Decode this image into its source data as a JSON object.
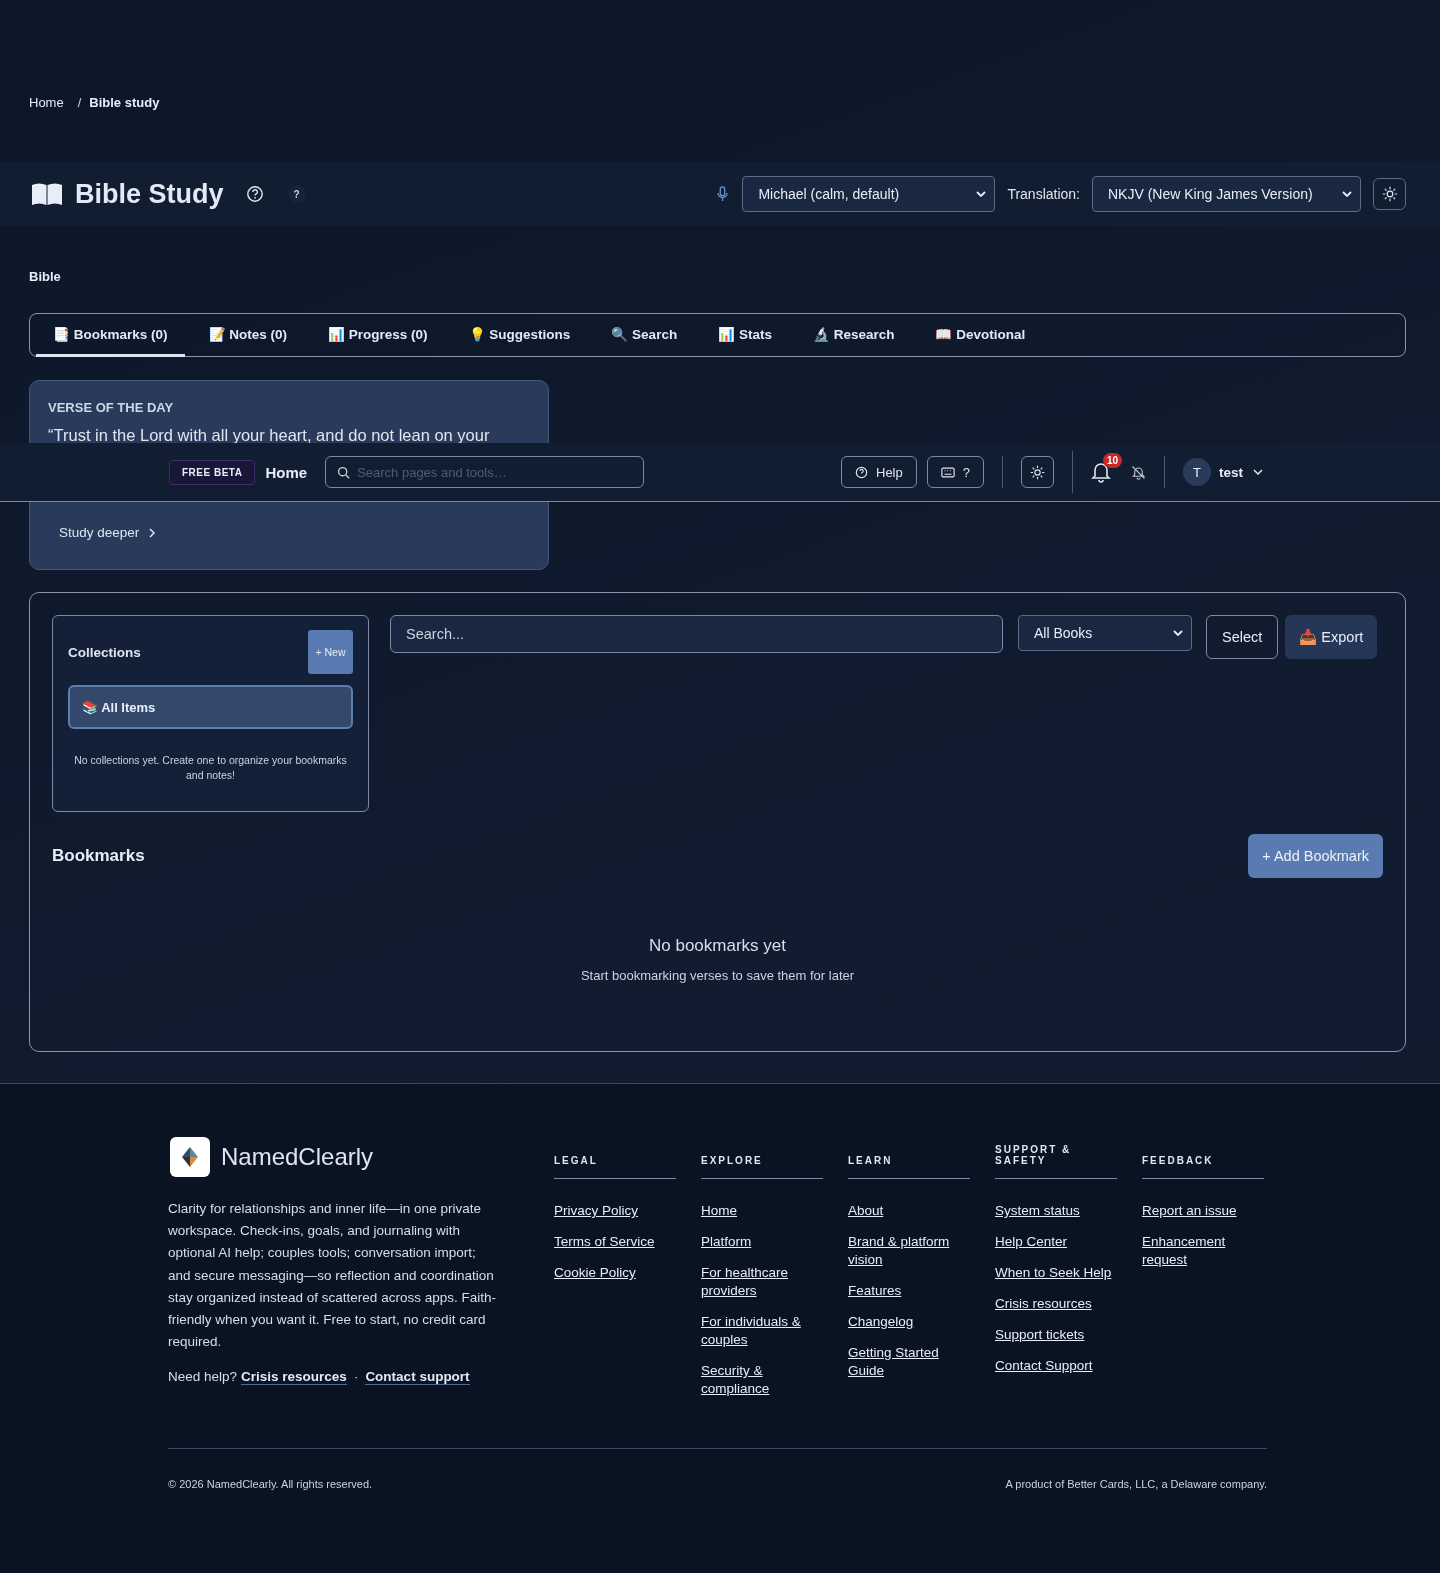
{
  "breadcrumb": [
    {
      "label": "Home",
      "current": false
    },
    {
      "label": "Bible study",
      "current": true
    }
  ],
  "breadcrumb_separator": "/",
  "header": {
    "title": "Bible Study",
    "help_badge": "?",
    "voice": "Michael (calm, default)",
    "translation_label": "Translation:",
    "translation": "NKJV (New King James Version)"
  },
  "section_label": "Bible",
  "tabs": [
    {
      "label": "📑 Bookmarks (0)",
      "selected": true
    },
    {
      "label": "📝 Notes (0)",
      "selected": false
    },
    {
      "label": "📊 Progress (0)",
      "selected": false
    },
    {
      "label": "💡 Suggestions",
      "selected": false
    },
    {
      "label": "🔍 Search",
      "selected": false
    },
    {
      "label": "📊 Stats",
      "selected": false
    },
    {
      "label": "🔬 Research",
      "selected": false
    },
    {
      "label": "📖 Devotional",
      "selected": false
    }
  ],
  "verse_card": {
    "heading": "VERSE OF THE DAY",
    "text": "“Trust in the Lord with all your heart, and do not lean on your",
    "link": "Study deeper"
  },
  "top_nav": {
    "badge": "FREE BETA",
    "home": "Home",
    "search_placeholder": "Search pages and tools…",
    "help": "Help",
    "shortcut": "?",
    "notification_count": "10",
    "user_initial": "T",
    "user_name": "test"
  },
  "collections": {
    "title": "Collections",
    "new_button": "+ New",
    "items": [
      {
        "label": "📚 All Items",
        "selected": true
      }
    ],
    "empty": "No collections yet. Create one to organize your bookmarks and notes!"
  },
  "filters": {
    "search_placeholder": "Search...",
    "book_filter": "All Books",
    "select_button": "Select",
    "export_button": "📥 Export"
  },
  "bookmarks": {
    "title": "Bookmarks",
    "add_button": "+ Add Bookmark",
    "empty_title": "No bookmarks yet",
    "empty_text": "Start bookmarking verses to save them for later"
  },
  "footer": {
    "brand": "NamedClearly",
    "description": "Clarity for relationships and inner life—in one private workspace. Check-ins, goals, and journaling with optional AI help; couples tools; conversation import; and secure messaging—so reflection and coordination stay organized instead of scattered across apps. Faith-friendly when you want it. Free to start, no credit card required.",
    "help_prefix": "Need help?",
    "help_links": [
      "Crisis resources",
      "Contact support"
    ],
    "help_separator": "·",
    "columns": [
      {
        "title": "LEGAL",
        "links": [
          "Privacy Policy",
          "Terms of Service",
          "Cookie Policy"
        ]
      },
      {
        "title": "EXPLORE",
        "links": [
          "Home",
          "Platform",
          "For healthcare providers",
          "For individuals & couples",
          "Security & compliance"
        ]
      },
      {
        "title": "LEARN",
        "links": [
          "About",
          "Brand & platform vision",
          "Features",
          "Changelog",
          "Getting Started Guide"
        ]
      },
      {
        "title": "SUPPORT & SAFETY",
        "links": [
          "System status",
          "Help Center",
          "When to Seek Help",
          "Crisis resources",
          "Support tickets",
          "Contact Support"
        ]
      },
      {
        "title": "FEEDBACK",
        "links": [
          "Report an issue",
          "Enhancement request"
        ]
      }
    ],
    "copyright": "© 2026 NamedClearly. All rights reserved.",
    "company": "A product of Better Cards, LLC, a Delaware company."
  }
}
